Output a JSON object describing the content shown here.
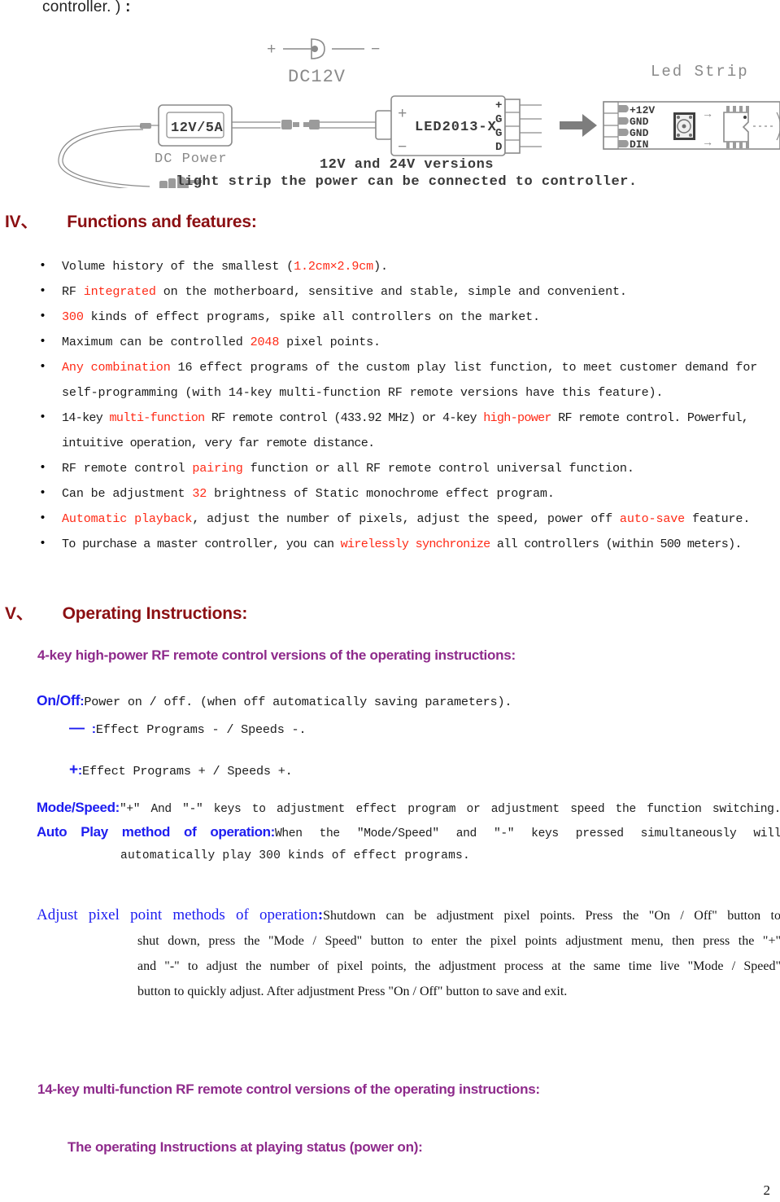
{
  "document": {
    "page_number": "2",
    "top_continuation": "controller. ) ",
    "top_continuation_bold": ":"
  },
  "diagram": {
    "caption_line1": "12V and 24V versions",
    "caption_line2": "light strip the power can be connected to controller.",
    "dc_plug_label": "DC12V",
    "dc_plug_plus": "+",
    "dc_plug_minus": "−",
    "psu_label": "12V/5A",
    "psu_caption": "DC Power",
    "controller_label": "LED2013-X",
    "controller_plus": "+",
    "controller_minus": "−",
    "controller_pins": [
      "+",
      "G",
      "G",
      "D"
    ],
    "led_strip_title": "Led Strip",
    "led_strip_pins": [
      "+12V",
      "GND",
      "GND",
      "DIN"
    ],
    "arrow_glyph": "→"
  },
  "section_iv": {
    "number": "IV、",
    "title": "Functions and features:",
    "bullets": [
      [
        {
          "t": "Volume history of the smallest (",
          "c": "black"
        },
        {
          "t": "1.2cm×2.9cm",
          "c": "red"
        },
        {
          "t": ").",
          "c": "black"
        }
      ],
      [
        {
          "t": "RF ",
          "c": "black"
        },
        {
          "t": "integrated",
          "c": "red"
        },
        {
          "t": " on the motherboard, sensitive and stable, simple and convenient.",
          "c": "black"
        }
      ],
      [
        {
          "t": "300",
          "c": "red"
        },
        {
          "t": " kinds of effect programs, spike all controllers on the market.",
          "c": "black"
        }
      ],
      [
        {
          "t": "Maximum can be controlled ",
          "c": "black"
        },
        {
          "t": "2048",
          "c": "red"
        },
        {
          "t": " pixel points.",
          "c": "black"
        }
      ],
      [
        {
          "t": "Any combination",
          "c": "red"
        },
        {
          "t": " 16 effect programs of the custom play list function, to meet customer demand for self-programming (with 14-key multi-function RF remote versions have this feature).",
          "c": "black"
        }
      ],
      [
        {
          "t": "14-key ",
          "c": "black"
        },
        {
          "t": "multi-function",
          "c": "red"
        },
        {
          "t": " RF remote control (433.92 MHz) or 4-key ",
          "c": "black"
        },
        {
          "t": "high-power",
          "c": "red"
        },
        {
          "t": " RF remote control. Powerful, intuitive operation, very far remote distance.",
          "c": "black"
        }
      ],
      [
        {
          "t": "RF remote control ",
          "c": "black"
        },
        {
          "t": "pairing",
          "c": "red"
        },
        {
          "t": " function or all RF remote control universal function.",
          "c": "black"
        }
      ],
      [
        {
          "t": "Can be adjustment ",
          "c": "black"
        },
        {
          "t": "32",
          "c": "red"
        },
        {
          "t": " brightness of Static monochrome effect program.",
          "c": "black"
        }
      ],
      [
        {
          "t": "Automatic playback",
          "c": "red"
        },
        {
          "t": ", adjust the number of pixels, adjust the speed, power off ",
          "c": "black"
        },
        {
          "t": "auto-save",
          "c": "red"
        },
        {
          "t": " feature.",
          "c": "black"
        }
      ],
      [
        {
          "t": "To purchase a master controller, you can ",
          "c": "black"
        },
        {
          "t": "wirelessly synchronize",
          "c": "red"
        },
        {
          "t": " all controllers (within 500 meters).",
          "c": "black"
        }
      ]
    ]
  },
  "section_v": {
    "number": "V、",
    "title": "Operating Instructions:",
    "heading_4key": "4-key high-power RF remote control versions of the operating instructions:",
    "onoff_key": "On/Off",
    "onoff_colon": ":",
    "onoff_text": "Power on / off. (when off automatically saving parameters).",
    "minus_key": "—",
    "minus_colon": ":",
    "minus_text": "Effect Programs - / Speeds -.",
    "plus_key": "+",
    "plus_colon": ":",
    "plus_text": "Effect Programs + / Speeds +.",
    "mode_speed_key": "Mode/Speed:",
    "mode_speed_text": "\"+\" And \"-\" keys to adjustment effect program or adjustment speed the function switching.",
    "autoplay_key": "Auto Play method of operation:",
    "autoplay_text_line1": "When the \"Mode/Speed\" and \"-\" keys pressed simultaneously will",
    "autoplay_text_line2": "automatically play 300 kinds of effect programs.",
    "adjust_key": "Adjust pixel point methods of operation",
    "adjust_key_colon": ":",
    "adjust_line1": "Shutdown can be adjustment pixel points. Press the \"On / Off\" button to",
    "adjust_line2": "shut down, press the \"Mode / Speed\" button to enter the pixel points adjustment menu, then press the \"+\"",
    "adjust_line3": "and \"-\" to adjust the number of pixel points, the adjustment process at the same time live \"Mode / Speed\"",
    "adjust_line4": "button to quickly adjust. After adjustment Press \"On / Off\" button to save and exit.",
    "heading_14key": "14-key multi-function RF remote control versions of the operating instructions:",
    "heading_playing_status": "The operating Instructions at playing status (power on):"
  },
  "colors": {
    "section_heading": "#8b0f12",
    "purple_heading": "#8e2a8b",
    "blue_key": "#1d1df0",
    "red_emphasis": "#ff2a16",
    "body_text": "#1c1c1c"
  }
}
